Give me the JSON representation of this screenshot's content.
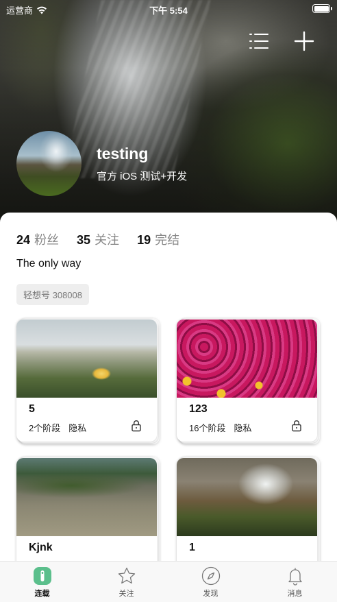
{
  "status_bar": {
    "carrier": "运营商",
    "time": "下午 5:54"
  },
  "profile": {
    "username": "testing",
    "tagline": "官方 iOS 测试+开发"
  },
  "stats": [
    {
      "count": "24",
      "label": "粉丝"
    },
    {
      "count": "35",
      "label": "关注"
    },
    {
      "count": "19",
      "label": "完结"
    }
  ],
  "motto": "The only way",
  "id_chip": "轻想号 308008",
  "cards": [
    {
      "title": "5",
      "stages": "2个阶段",
      "privacy": "隐私"
    },
    {
      "title": "123",
      "stages": "16个阶段",
      "privacy": "隐私"
    },
    {
      "title": "Kjnk",
      "stages": "",
      "privacy": ""
    },
    {
      "title": "1",
      "stages": "",
      "privacy": ""
    }
  ],
  "tabbar": {
    "items": [
      {
        "label": "连载",
        "icon": "serial-icon",
        "active": true
      },
      {
        "label": "关注",
        "icon": "star-icon",
        "active": false
      },
      {
        "label": "发现",
        "icon": "compass-icon",
        "active": false
      },
      {
        "label": "消息",
        "icon": "bell-icon",
        "active": false
      }
    ]
  },
  "colors": {
    "accent": "#5bbf8c",
    "chip_bg": "#eeeeee",
    "muted": "#888888"
  }
}
